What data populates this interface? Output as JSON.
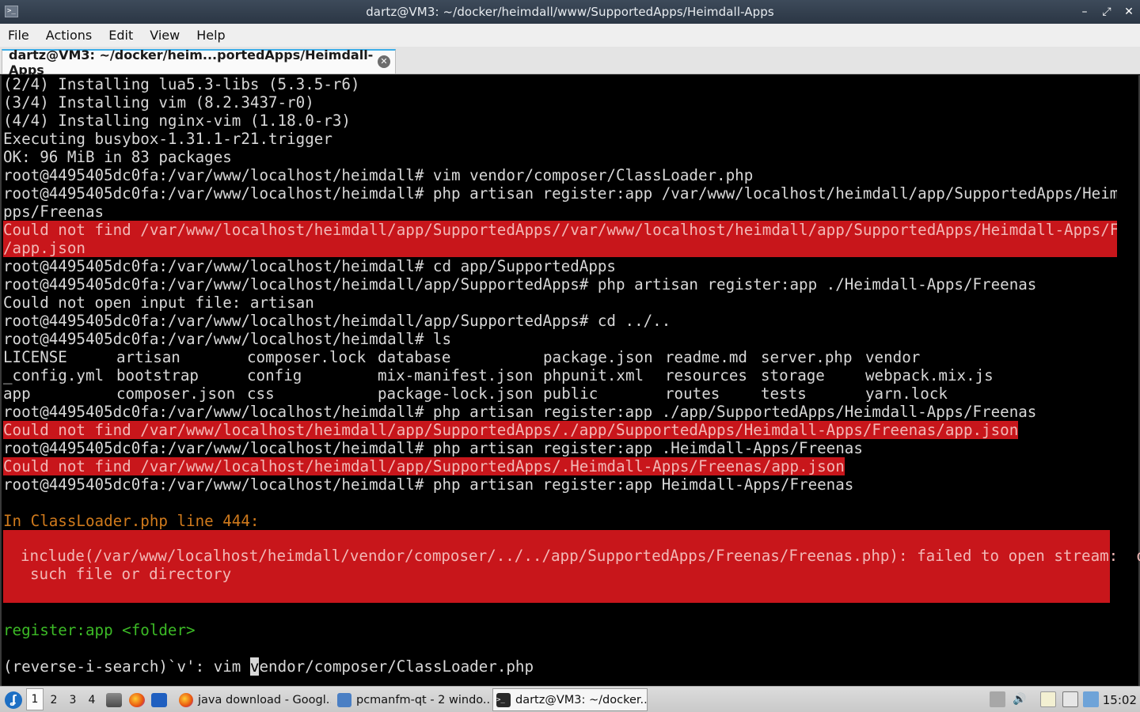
{
  "window": {
    "title": "dartz@VM3: ~/docker/heimdall/www/SupportedApps/Heimdall-Apps",
    "controls": [
      "–",
      "⤢",
      "✕"
    ]
  },
  "menu": [
    "File",
    "Actions",
    "Edit",
    "View",
    "Help"
  ],
  "tab": {
    "label": "dartz@VM3: ~/docker/heim...portedApps/Heimdall-Apps"
  },
  "terminal": {
    "lines": [
      "(2/4) Installing lua5.3-libs (5.3.5-r6)",
      "(3/4) Installing vim (8.2.3437-r0)",
      "(4/4) Installing nginx-vim (1.18.0-r3)",
      "Executing busybox-1.31.1-r21.trigger",
      "OK: 96 MiB in 83 packages",
      "root@4495405dc0fa:/var/www/localhost/heimdall# vim vendor/composer/ClassLoader.php",
      "root@4495405dc0fa:/var/www/localhost/heimdall# php artisan register:app /var/www/localhost/heimdall/app/SupportedApps/Heimdall-A",
      "pps/Freenas"
    ],
    "error1": [
      "Could not find /var/www/localhost/heimdall/app/SupportedApps//var/www/localhost/heimdall/app/SupportedApps/Heimdall-Apps/Freenas",
      "/app.json"
    ],
    "lines2": [
      "root@4495405dc0fa:/var/www/localhost/heimdall# cd app/SupportedApps",
      "root@4495405dc0fa:/var/www/localhost/heimdall/app/SupportedApps# php artisan register:app ./Heimdall-Apps/Freenas",
      "Could not open input file: artisan",
      "root@4495405dc0fa:/var/www/localhost/heimdall/app/SupportedApps# cd ../..",
      "root@4495405dc0fa:/var/www/localhost/heimdall# ls"
    ],
    "ls_rows": [
      [
        "LICENSE",
        "artisan",
        "composer.lock",
        "database",
        "package.json",
        "readme.md",
        "server.php",
        "vendor"
      ],
      [
        "_config.yml",
        "bootstrap",
        "config",
        "mix-manifest.json",
        "phpunit.xml",
        "resources",
        "storage",
        "webpack.mix.js"
      ],
      [
        "app",
        "composer.json",
        "css",
        "package-lock.json",
        "public",
        "routes",
        "tests",
        "yarn.lock"
      ]
    ],
    "cmd3": "root@4495405dc0fa:/var/www/localhost/heimdall# php artisan register:app ./app/SupportedApps/Heimdall-Apps/Freenas",
    "error2": "Could not find /var/www/localhost/heimdall/app/SupportedApps/./app/SupportedApps/Heimdall-Apps/Freenas/app.json",
    "cmd4": "root@4495405dc0fa:/var/www/localhost/heimdall# php artisan register:app .Heimdall-Apps/Freenas",
    "error3": "Could not find /var/www/localhost/heimdall/app/SupportedApps/.Heimdall-Apps/Freenas/app.json",
    "cmd5": "root@4495405dc0fa:/var/www/localhost/heimdall# php artisan register:app Heimdall-Apps/Freenas",
    "exception_header": "In ClassLoader.php line 444:",
    "exception_line1": "include(/var/www/localhost/heimdall/vendor/composer/../../app/SupportedApps/Freenas/Freenas.php): failed to open stream: No",
    "exception_line2": "such file or directory",
    "usage": "register:app <folder>",
    "search_prefix": "(reverse-i-search)`v': vim ",
    "search_cursor_char": "v",
    "search_suffix": "endor/composer/ClassLoader.php"
  },
  "taskbar": {
    "desktops": [
      "1",
      "2",
      "3",
      "4"
    ],
    "tasks": [
      {
        "label": "java download - Googl...",
        "icon": "firefox-icon"
      },
      {
        "label": "pcmanfm-qt - 2 windo...",
        "icon": "folder-icon"
      },
      {
        "label": "dartz@VM3: ~/docker...",
        "icon": "terminal-icon"
      }
    ],
    "clock": "15:02"
  },
  "colors": {
    "error_bg": "#c8161b",
    "yellow_text": "#d07a1c",
    "green_text": "#3cba26",
    "tab_accent": "#3daee9"
  }
}
